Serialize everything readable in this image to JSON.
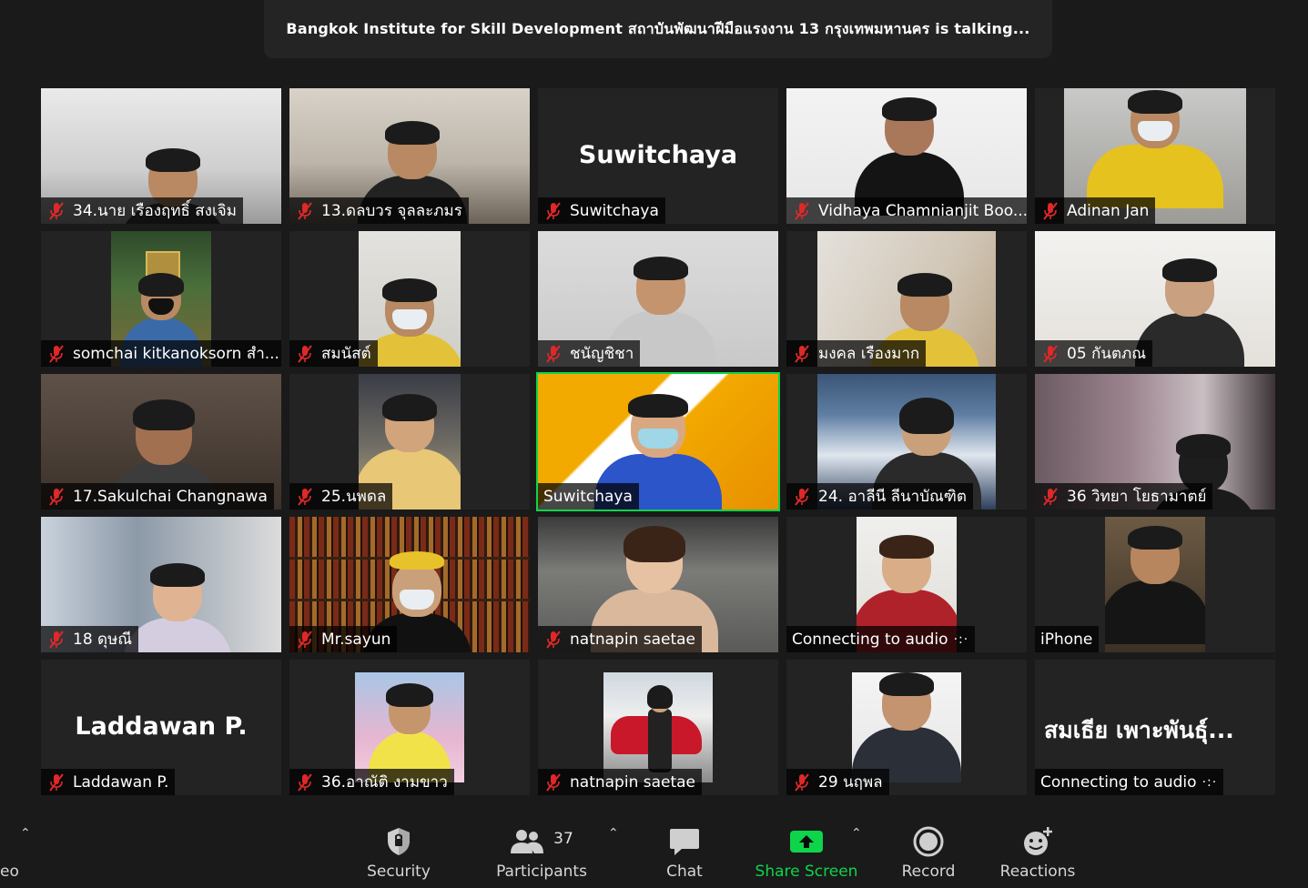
{
  "banner": {
    "text": "Bangkok Institute for Skill Development สถาบันพัฒนาฝีมือแรงงาน 13 กรุงเทพมหานคร is talking..."
  },
  "tiles": [
    {
      "name": "34.นาย เรืองฤทธิ์ สงเจิม",
      "muted": true
    },
    {
      "name": "13.ดลบวร จุลละภมร",
      "muted": true
    },
    {
      "name": "Suwitchaya",
      "muted": true,
      "display_name": "Suwitchaya"
    },
    {
      "name": "Vidhaya Chamnianjit Boo...",
      "muted": true
    },
    {
      "name": "Adinan Jan",
      "muted": true
    },
    {
      "name": "somchai kitkanoksorn สำ...",
      "muted": true
    },
    {
      "name": "สมนัสต์",
      "muted": true
    },
    {
      "name": "ชนัญชิชา",
      "muted": true
    },
    {
      "name": "มงคล เรืองมาก",
      "muted": true
    },
    {
      "name": "05 กันตภณ",
      "muted": true
    },
    {
      "name": "17.Sakulchai Changnawa",
      "muted": true
    },
    {
      "name": "25.นพดล",
      "muted": true
    },
    {
      "name": "Suwitchaya",
      "muted": false
    },
    {
      "name": "24. อาลีนี ลีนาบัณฑิต",
      "muted": true
    },
    {
      "name": "36 วิทยา โยธามาตย์",
      "muted": true
    },
    {
      "name": "18 ดุษณี",
      "muted": true
    },
    {
      "name": "Mr.sayun",
      "muted": true
    },
    {
      "name": "natnapin saetae",
      "muted": true
    },
    {
      "name": "Connecting to audio",
      "muted": false,
      "connecting": true
    },
    {
      "name": "iPhone",
      "muted": false
    },
    {
      "name": "Laddawan P.",
      "muted": true,
      "display_name": "Laddawan P."
    },
    {
      "name": "36.อาณัติ งามขาว",
      "muted": true
    },
    {
      "name": "natnapin saetae",
      "muted": true
    },
    {
      "name": "29 นฤพล",
      "muted": true
    },
    {
      "name": "Connecting to audio",
      "muted": false,
      "connecting": true,
      "display_name": "สมเธีย เพาะพันธุ์..."
    }
  ],
  "toolbar": {
    "left_cut_label": "eo",
    "security": "Security",
    "participants": "Participants",
    "participants_count": "37",
    "chat": "Chat",
    "share_screen": "Share Screen",
    "record": "Record",
    "reactions": "Reactions"
  },
  "colors": {
    "share_green": "#0ed44a",
    "muted_red": "#e02828",
    "background": "#1a1a1a"
  }
}
